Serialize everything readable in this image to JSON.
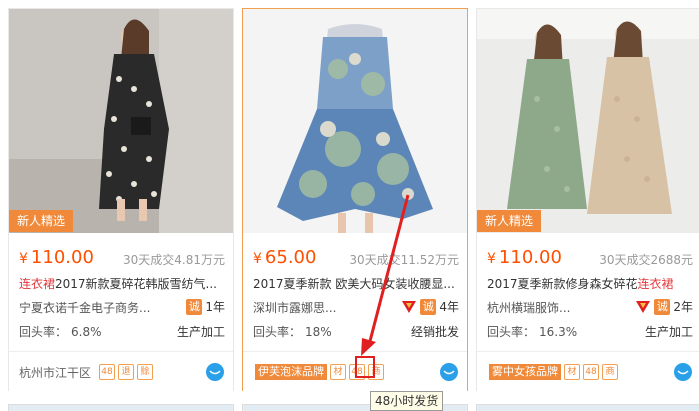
{
  "cards": [
    {
      "badge": "新人精选",
      "price_yen": "¥",
      "price": "110.00",
      "deal": "30天成交4.81万元",
      "title_hl": "连衣裙",
      "title_rest": "2017新款夏碎花韩版雪纺气...",
      "company": "宁夏衣诺千金电子商务...",
      "years": "1年",
      "rate_label": "回头率：",
      "rate_value": "6.8%",
      "mode": "生产加工",
      "location": "杭州市江干区",
      "services": [
        "48",
        "退",
        "赊"
      ]
    },
    {
      "badge": "",
      "price_yen": "¥",
      "price": "65.00",
      "deal": "30天成交11.52万元",
      "title_hl": "",
      "title_rest": "2017夏季新款 欧美大码女装收腰显...",
      "company": "深圳市露娜思...",
      "years": "4年",
      "rate_label": "回头率：",
      "rate_value": "18%",
      "mode": "经销批发",
      "brand": "伊芙泡沫",
      "brand_sub": "品牌",
      "services": [
        "材",
        "48",
        "商"
      ]
    },
    {
      "badge": "新人精选",
      "price_yen": "¥",
      "price": "110.00",
      "deal": "30天成交2688元",
      "title_pre": "2017夏季新款修身森女碎花",
      "title_hl": "连衣裙",
      "company": "杭州横瑞服饰...",
      "years": "2年",
      "rate_label": "回头率：",
      "rate_value": "16.3%",
      "mode": "生产加工",
      "brand": "雾中女孩",
      "brand_sub": "品牌",
      "services": [
        "材",
        "48",
        "商"
      ]
    }
  ],
  "icons": {
    "chat": "chat-bubble-icon",
    "cheng": "诚",
    "shield": "shield-badge-icon"
  },
  "tooltip": "48小时发货",
  "colors": {
    "accent": "#f08a3a",
    "price": "#ff4f00",
    "highlight": "#e4393c",
    "annotation": "#e02020"
  }
}
